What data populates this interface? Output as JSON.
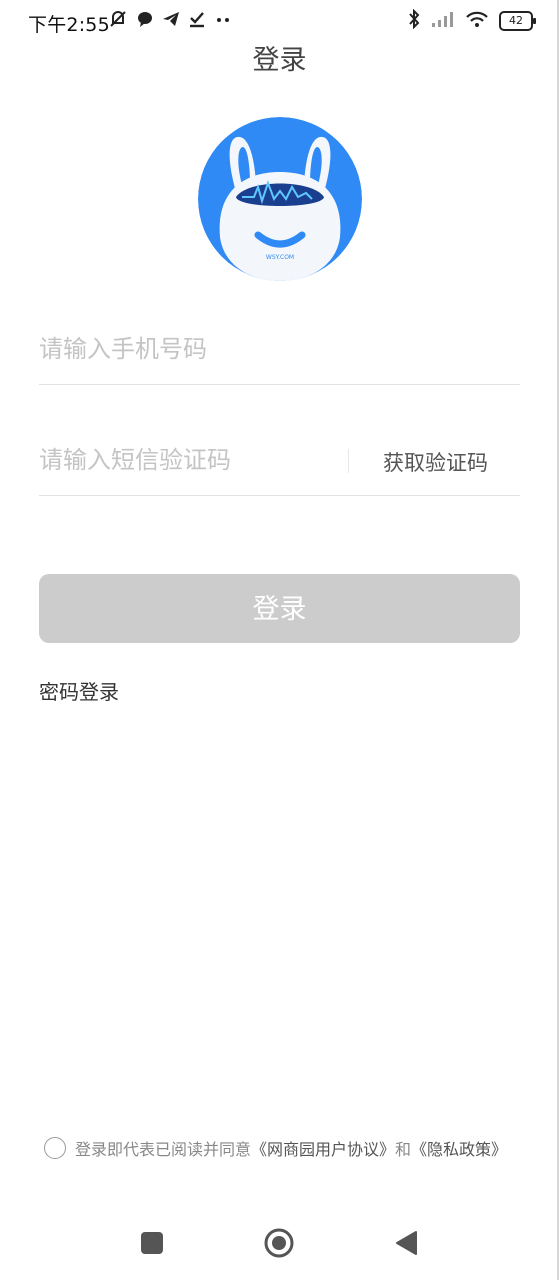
{
  "status_bar": {
    "time": "下午2:55",
    "battery": "42"
  },
  "header": {
    "title": "登录"
  },
  "form": {
    "phone_placeholder": "请输入手机号码",
    "code_placeholder": "请输入短信验证码",
    "get_code_label": "获取验证码",
    "login_label": "登录",
    "password_login_label": "密码登录"
  },
  "agreement": {
    "prefix": "登录即代表已阅读并同意",
    "user_agreement": "《网商园用户协议》",
    "connector": "和",
    "privacy_policy": "《隐私政策》"
  },
  "colors": {
    "accent_blue": "#2f8af5",
    "button_disabled": "#cccccc"
  },
  "icons": [
    "mute-icon",
    "chat-icon",
    "telegram-icon",
    "check-icon",
    "more-dots-icon",
    "bluetooth-icon",
    "signal-icon",
    "wifi-icon",
    "battery-icon",
    "recent-apps-icon",
    "home-icon",
    "back-icon"
  ]
}
